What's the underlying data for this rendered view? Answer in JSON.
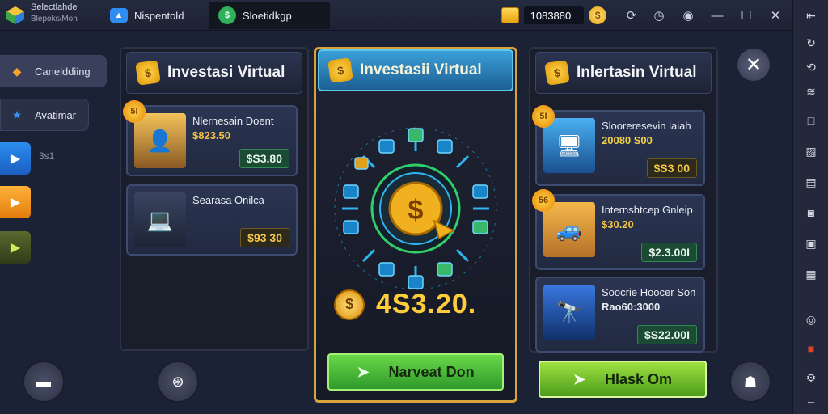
{
  "app": {
    "title": "Selectlahde",
    "subtitle": "Blepoks/Mon",
    "tabs": [
      {
        "label": "Nispentold",
        "icon": "app-tab-icon"
      },
      {
        "label": "Sloetidkgp",
        "icon": "game-tab-icon"
      }
    ],
    "coins": "1083880",
    "accent": "#d8a33a"
  },
  "side": {
    "items": [
      {
        "label": "Canelddiing"
      },
      {
        "label": "Avatimar"
      }
    ],
    "number": "3s1"
  },
  "panels": {
    "left": {
      "title": "Investasi Virtual",
      "cards": [
        {
          "title": "Nlernesain Doent",
          "subtitle": "$823.50",
          "price": "$S3.80",
          "badge": "5I"
        },
        {
          "title": "Searasa Onilca",
          "subtitle": "",
          "price": "$93 30"
        }
      ]
    },
    "center": {
      "title": "Investasii Virtual",
      "amount": "4S3.20.",
      "button": "Narveat Don"
    },
    "right": {
      "title": "Inlertasin Virtual",
      "cards": [
        {
          "title": "Slooreresevin laiah",
          "subtitle": "20080 S00",
          "price": "$S3 00",
          "badge": "5I"
        },
        {
          "title": "Internshtcep Gnleip",
          "subtitle": "$30.20",
          "price": "$2.3.00I",
          "badge": "56"
        },
        {
          "title": "Soocrie Hoocer Son",
          "subtitle": "Rao60:3000",
          "price": "$S22.00I"
        }
      ],
      "button": "Hlask Om"
    }
  }
}
